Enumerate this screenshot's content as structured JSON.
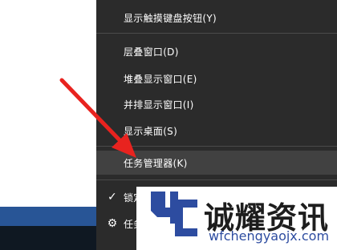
{
  "menu": {
    "items": [
      {
        "label": "显示触摸键盘按钮(Y)"
      },
      {
        "label": "层叠窗口(D)"
      },
      {
        "label": "堆叠显示窗口(E)"
      },
      {
        "label": "并排显示窗口(I)"
      },
      {
        "label": "显示桌面(S)"
      },
      {
        "label": "任务管理器(K)"
      },
      {
        "label": "锁定任务栏(L)"
      },
      {
        "label": "任务栏设置(T)"
      }
    ],
    "highlighted_index": 5,
    "checked": [
      "锁定任务栏(L)"
    ],
    "icons": [
      "check-icon",
      "gear-icon"
    ]
  },
  "watermark": {
    "title": "诚耀资讯",
    "subtitle": "wfchengyaojx.com",
    "logo": "4c-logo"
  },
  "colors": {
    "menu_bg": "#2b2b2b",
    "menu_hover": "#414141",
    "arrow": "#e8231f",
    "taskbar": "#285596",
    "watermark_blue": "#2d4ca0"
  }
}
